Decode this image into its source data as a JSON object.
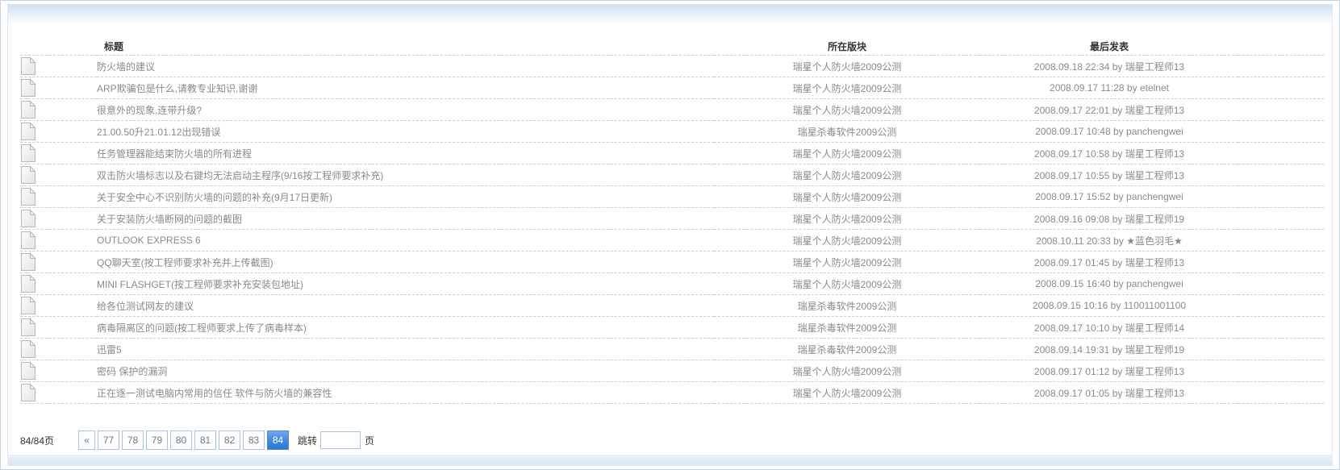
{
  "colors": {
    "accent_blue": "#4a89dc",
    "pager_border_blue": "#a6c3e3",
    "link_gray": "#8a8a8a",
    "header_text": "#333333",
    "top_bar_blue": "#d7e4f4"
  },
  "table": {
    "headers": {
      "title": "标题",
      "forum": "所在版块",
      "last_post": "最后发表"
    },
    "by_label": "by",
    "rows": [
      {
        "title": "防火墙的建议",
        "forum": "瑞星个人防火墙2009公测",
        "date": "2008.09.18 22:34",
        "author": "瑞星工程师13"
      },
      {
        "title": "ARP欺骗包是什么,请教专业知识,谢谢",
        "forum": "瑞星个人防火墙2009公测",
        "date": "2008.09.17 11:28",
        "author": "etelnet"
      },
      {
        "title": "很意外的现象,连带升级?",
        "forum": "瑞星个人防火墙2009公测",
        "date": "2008.09.17 22:01",
        "author": "瑞星工程师13"
      },
      {
        "title": "21.00.50升21.01.12出现错误",
        "forum": "瑞星杀毒软件2009公测",
        "date": "2008.09.17 10:48",
        "author": "panchengwei"
      },
      {
        "title": "任务管理器能结束防火墙的所有进程",
        "forum": "瑞星个人防火墙2009公测",
        "date": "2008.09.17 10:58",
        "author": "瑞星工程师13"
      },
      {
        "title": "双击防火墙标志以及右键均无法启动主程序(9/16按工程师要求补充)",
        "forum": "瑞星个人防火墙2009公测",
        "date": "2008.09.17 10:55",
        "author": "瑞星工程师13"
      },
      {
        "title": "关于安全中心不识别防火墙的问题的补充(9月17日更新)",
        "forum": "瑞星个人防火墙2009公测",
        "date": "2008.09.17 15:52",
        "author": "panchengwei"
      },
      {
        "title": "关于安装防火墙断网的问题的截图",
        "forum": "瑞星个人防火墙2009公测",
        "date": "2008.09.16 09:08",
        "author": "瑞星工程师19"
      },
      {
        "title": "OUTLOOK EXPRESS 6",
        "forum": "瑞星个人防火墙2009公测",
        "date": "2008.10.11 20:33",
        "author": "★蓝色羽毛★"
      },
      {
        "title": "QQ聊天室(按工程师要求补充并上传截图)",
        "forum": "瑞星个人防火墙2009公测",
        "date": "2008.09.17 01:45",
        "author": "瑞星工程师13"
      },
      {
        "title": "MINI FLASHGET(按工程师要求补充安装包地址)",
        "forum": "瑞星个人防火墙2009公测",
        "date": "2008.09.15 16:40",
        "author": "panchengwei"
      },
      {
        "title": "给各位测试网友的建议",
        "forum": "瑞星杀毒软件2009公测",
        "date": "2008.09.15 10:16",
        "author": "110011001100"
      },
      {
        "title": "病毒隔离区的问题(按工程师要求上传了病毒样本)",
        "forum": "瑞星杀毒软件2009公测",
        "date": "2008.09.17 10:10",
        "author": "瑞星工程师14"
      },
      {
        "title": "迅雷5",
        "forum": "瑞星杀毒软件2009公测",
        "date": "2008.09.14 19:31",
        "author": "瑞星工程师19"
      },
      {
        "title": "密码 保护的漏洞",
        "forum": "瑞星个人防火墙2009公测",
        "date": "2008.09.17 01:12",
        "author": "瑞星工程师13"
      },
      {
        "title": "正在逐一测试电脑内常用的信任 软件与防火墙的兼容性",
        "forum": "瑞星个人防火墙2009公测",
        "date": "2008.09.17 01:05",
        "author": "瑞星工程师13"
      }
    ]
  },
  "pagination": {
    "info": "84/84页",
    "prev_label": "«",
    "pages": [
      "77",
      "78",
      "79",
      "80",
      "81",
      "82",
      "83",
      "84"
    ],
    "active_page": "84",
    "jump_label": "跳转",
    "jump_value": "",
    "page_suffix": "页"
  }
}
